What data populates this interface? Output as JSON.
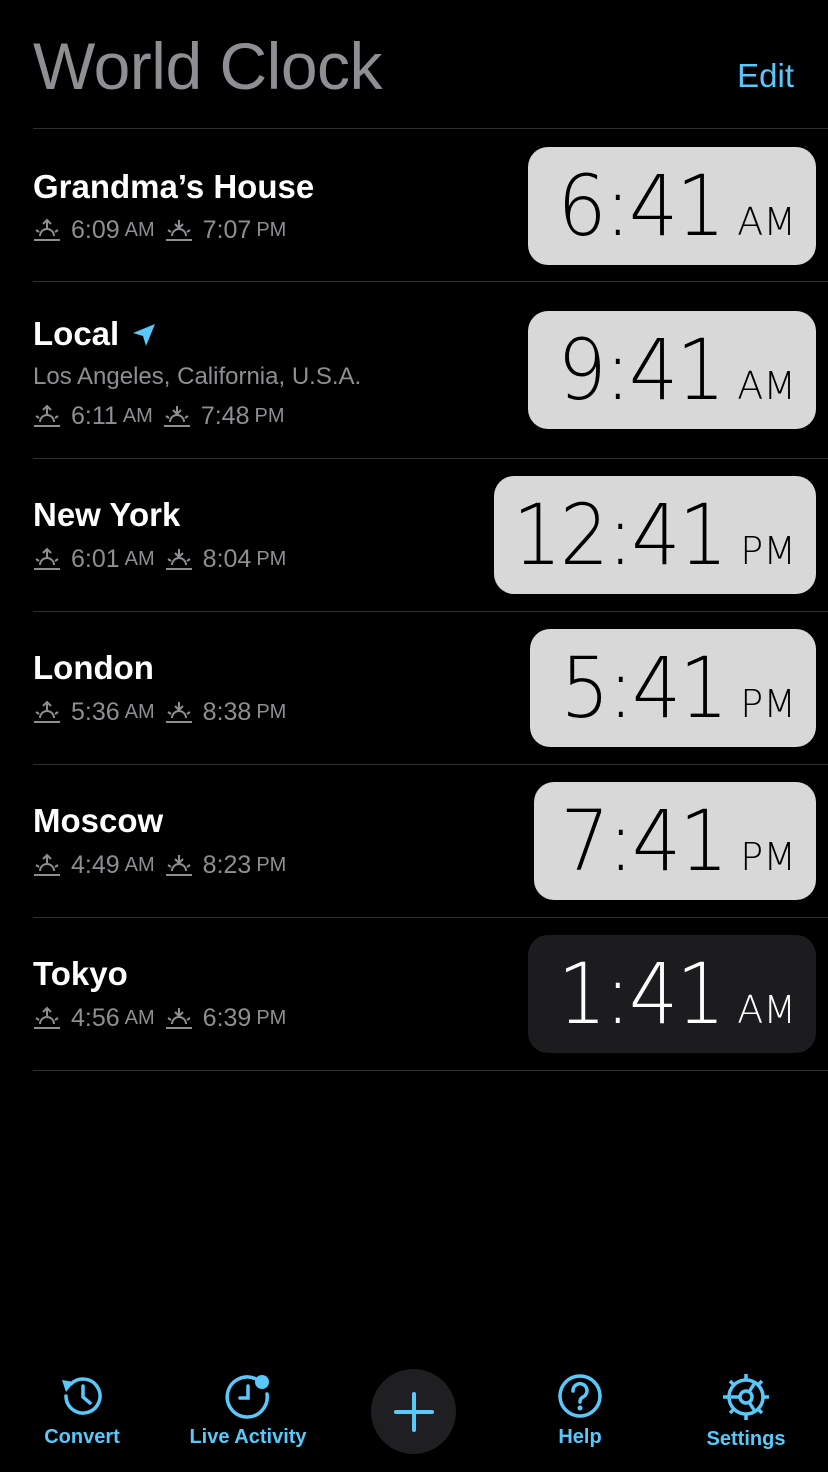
{
  "header": {
    "title": "World Clock",
    "edit_label": "Edit"
  },
  "cities": [
    {
      "name": "Grandma’s House",
      "subtitle": "",
      "sunrise": "6:09",
      "sunrise_ampm": "AM",
      "sunset": "7:07",
      "sunset_ampm": "PM",
      "time": "6:41",
      "ampm": "AM",
      "night": false
    },
    {
      "name": "Local",
      "subtitle": "Los Angeles, California, U.S.A.",
      "sunrise": "6:11",
      "sunrise_ampm": "AM",
      "sunset": "7:48",
      "sunset_ampm": "PM",
      "time": "9:41",
      "ampm": "AM",
      "night": false
    },
    {
      "name": "New York",
      "subtitle": "",
      "sunrise": "6:01",
      "sunrise_ampm": "AM",
      "sunset": "8:04",
      "sunset_ampm": "PM",
      "time": "12:41",
      "ampm": "PM",
      "night": false
    },
    {
      "name": "London",
      "subtitle": "",
      "sunrise": "5:36",
      "sunrise_ampm": "AM",
      "sunset": "8:38",
      "sunset_ampm": "PM",
      "time": "5:41",
      "ampm": "PM",
      "night": false
    },
    {
      "name": "Moscow",
      "subtitle": "",
      "sunrise": "4:49",
      "sunrise_ampm": "AM",
      "sunset": "8:23",
      "sunset_ampm": "PM",
      "time": "7:41",
      "ampm": "PM",
      "night": false
    },
    {
      "name": "Tokyo",
      "subtitle": "",
      "sunrise": "4:56",
      "sunrise_ampm": "AM",
      "sunset": "6:39",
      "sunset_ampm": "PM",
      "time": "1:41",
      "ampm": "AM",
      "night": true
    }
  ],
  "tabbar": {
    "convert_label": "Convert",
    "live_activity_label": "Live Activity",
    "help_label": "Help",
    "settings_label": "Settings"
  },
  "colors": {
    "accent": "#5ac8fa",
    "background": "#000000",
    "day_clock": "#d8d8d8",
    "night_clock": "#1c1c1e",
    "secondary_text": "#8e8e93"
  },
  "icons": {
    "sunrise": "sunrise-icon",
    "sunset": "sunset-icon",
    "location": "location-arrow-icon",
    "convert": "clock-history-icon",
    "live_activity": "clock-badge-icon",
    "add": "plus-icon",
    "help": "question-mark-icon",
    "settings": "gear-icon"
  }
}
